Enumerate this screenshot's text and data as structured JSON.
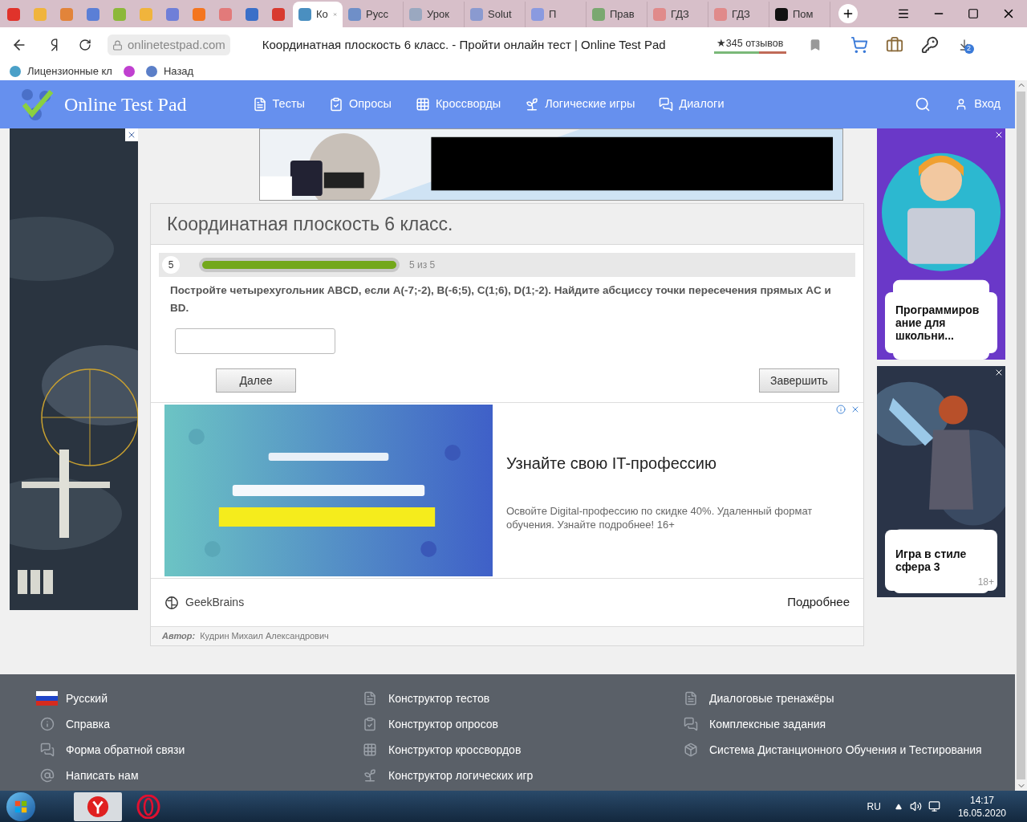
{
  "browser": {
    "tabs": [
      {
        "selected": false,
        "color": "#e0332b"
      },
      {
        "selected": false,
        "color": "#f0b43c"
      },
      {
        "selected": false,
        "color": "#e2843a"
      },
      {
        "selected": false,
        "color": "#5b7fd6"
      },
      {
        "selected": false,
        "color": "#8cb83a"
      },
      {
        "selected": false,
        "color": "#f0b43c"
      },
      {
        "selected": false,
        "color": "#6f7fd8"
      },
      {
        "selected": false,
        "color": "#f4751f"
      },
      {
        "selected": false,
        "color": "#e27a7a"
      },
      {
        "selected": false,
        "color": "#3a6fc8"
      },
      {
        "selected": false,
        "color": "#d83a2f"
      },
      {
        "title": "Ко",
        "selected": true,
        "color": "#4a8fc0"
      },
      {
        "title": "Русс",
        "selected": false,
        "color": "#6f8fc8"
      },
      {
        "title": "Урок",
        "selected": false,
        "color": "#9aa8c0"
      },
      {
        "title": "Solut",
        "selected": false,
        "color": "#8a9ad0"
      },
      {
        "title": "П",
        "selected": false,
        "color": "#8a9ae0"
      },
      {
        "title": "Прав",
        "selected": false,
        "color": "#7aa870"
      },
      {
        "title": "ГДЗ",
        "selected": false,
        "color": "#e08a8a"
      },
      {
        "title": "ГДЗ",
        "selected": false,
        "color": "#e08a8a"
      },
      {
        "title": "Пом",
        "selected": false,
        "color": "#111111"
      }
    ],
    "address": "onlinetestpad.com",
    "page_title": "Координатная плоскость 6 класс. - Пройти онлайн тест | Online Test Pad",
    "reviews": {
      "label": "★345 отзывов",
      "level": 0.63
    },
    "downloads_badge": "2",
    "bookmarks": [
      {
        "label": "Лицензионные кл",
        "color": "#4aa0c8"
      },
      {
        "color": "#c040d0"
      },
      {
        "label": "Назад",
        "color": "#5b7fc8"
      }
    ]
  },
  "site": {
    "logo": "Online Test Pad",
    "nav": [
      {
        "label": "Тесты",
        "kind": "doc"
      },
      {
        "label": "Опросы",
        "kind": "poll"
      },
      {
        "label": "Кроссворды",
        "kind": "grid"
      },
      {
        "label": "Логические игры",
        "kind": "leaf"
      },
      {
        "label": "Диалоги",
        "kind": "chat"
      }
    ],
    "login": "Вход"
  },
  "test": {
    "title": "Координатная плоскость 6 класс.",
    "question_number": "5",
    "progress": {
      "level": 1.0,
      "label": "5 из 5"
    },
    "question": "Постройте четырехугольник ABCD, если A(-7;-2), B(-6;5), C(1;6), D(1;-2). Найдите абсциссу точки пересечения прямых AC и BD.",
    "buttons": [
      "Далее",
      "Завершить"
    ],
    "ad": {
      "headline": "Узнайте свою IT-профессию",
      "body": "Освойте Digital-профессию по скидке 40%. Удаленный формат обучения. Узнайте подробнее! 16+",
      "advertiser": "GeekBrains",
      "more": "Подробнее"
    },
    "author_label": "Автор:",
    "author": "Кудрин Михаил Александрович"
  },
  "side_ads": [
    {
      "title": "Программиров ание для школьни..."
    },
    {
      "title": "Игра в стиле сфера 3",
      "age": "18+"
    }
  ],
  "footer": {
    "columns": [
      [
        {
          "label": "Русский",
          "kind": "flag"
        },
        {
          "label": "Справка",
          "kind": "info"
        },
        {
          "label": "Форма обратной связи",
          "kind": "chat"
        },
        {
          "label": "Написать нам",
          "kind": "at"
        }
      ],
      [
        {
          "label": "Конструктор тестов",
          "kind": "doc"
        },
        {
          "label": "Конструктор опросов",
          "kind": "poll"
        },
        {
          "label": "Конструктор кроссвордов",
          "kind": "grid"
        },
        {
          "label": "Конструктор логических игр",
          "kind": "leaf"
        }
      ],
      [
        {
          "label": "Диалоговые тренажёры",
          "kind": "doc"
        },
        {
          "label": "Комплексные задания",
          "kind": "chat"
        },
        {
          "label": "Система Дистанционного Обучения и Тестирования",
          "kind": "box"
        }
      ]
    ]
  },
  "taskbar": {
    "language": "RU",
    "time": "14:17",
    "date": "16.05.2020"
  }
}
